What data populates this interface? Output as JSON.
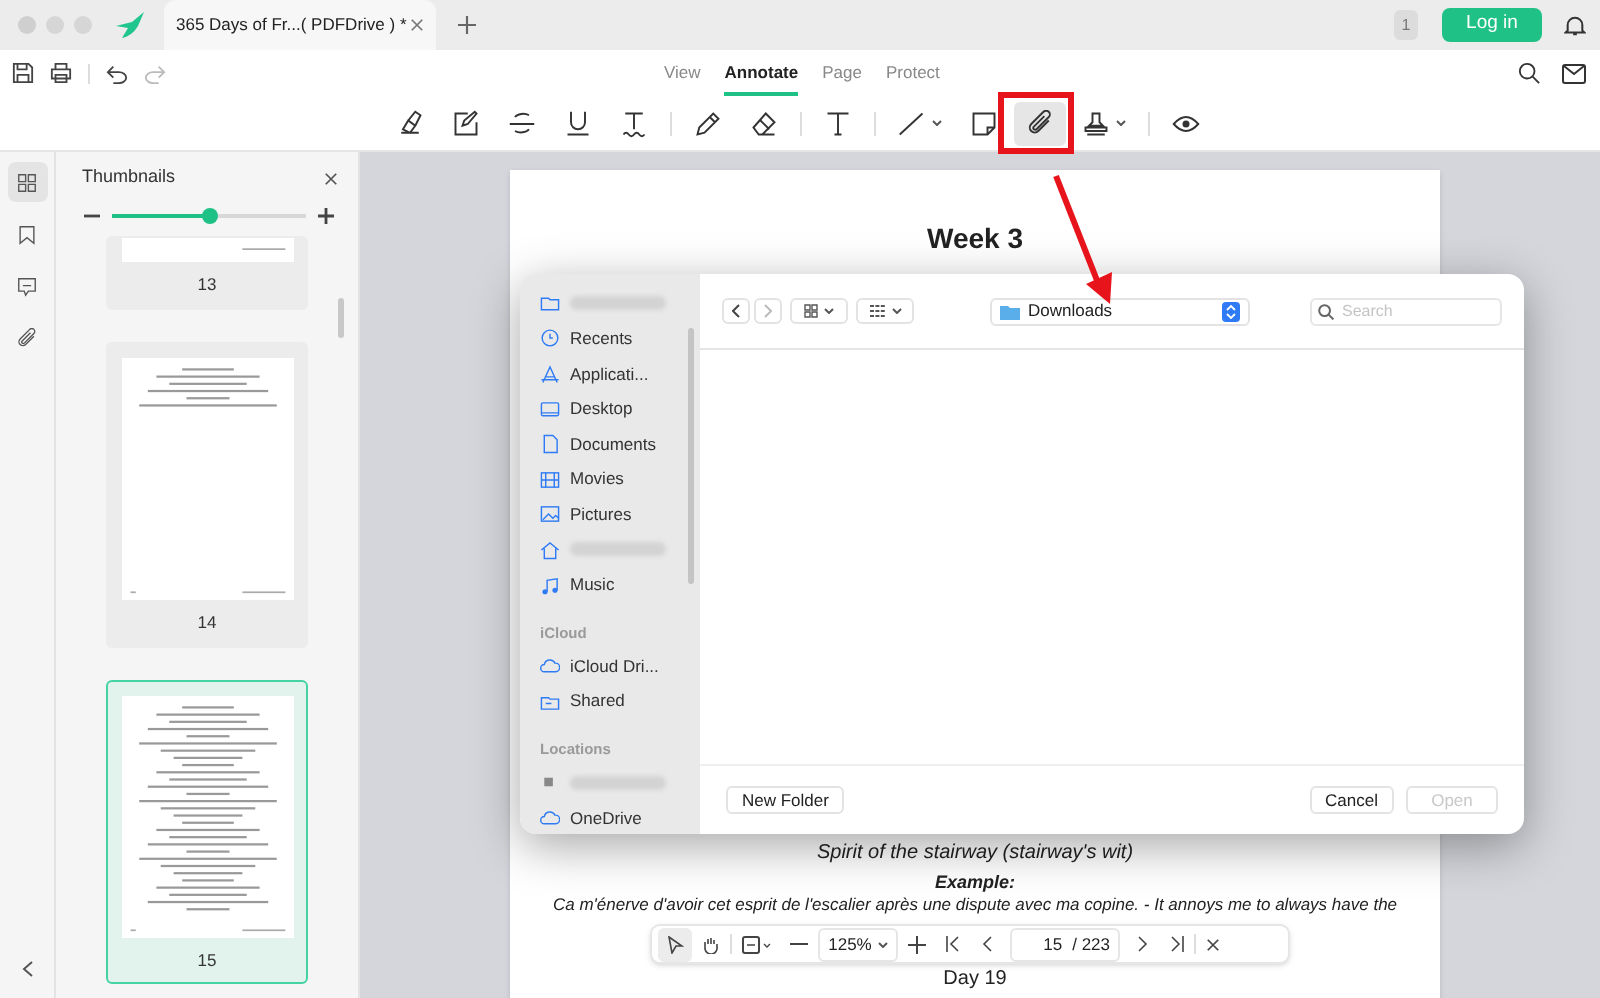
{
  "app_tab": {
    "title": "365 Days of Fr...( PDFDrive ) *"
  },
  "header": {
    "badge": "1",
    "login": "Log in"
  },
  "mode_tabs": [
    {
      "label": "View",
      "selected": false
    },
    {
      "label": "Annotate",
      "selected": true
    },
    {
      "label": "Page",
      "selected": false
    },
    {
      "label": "Protect",
      "selected": false
    }
  ],
  "tools": [
    {
      "kind": "highlighter",
      "selected": false
    },
    {
      "kind": "area",
      "selected": false
    },
    {
      "kind": "strikethrough",
      "selected": false
    },
    {
      "kind": "underline",
      "selected": false
    },
    {
      "kind": "squiggly",
      "selected": false
    },
    {
      "kind": "separator"
    },
    {
      "kind": "pencil",
      "selected": false
    },
    {
      "kind": "eraser",
      "selected": false
    },
    {
      "kind": "separator"
    },
    {
      "kind": "text",
      "selected": false
    },
    {
      "kind": "separator"
    },
    {
      "kind": "line",
      "selected": false
    },
    {
      "kind": "note",
      "selected": false
    },
    {
      "kind": "attachment",
      "selected": true
    },
    {
      "kind": "stamp",
      "selected": false
    },
    {
      "kind": "separator"
    },
    {
      "kind": "eye",
      "selected": false
    }
  ],
  "rail": [
    {
      "kind": "thumbnails",
      "selected": true
    },
    {
      "kind": "bookmark",
      "selected": false
    },
    {
      "kind": "comment",
      "selected": false
    },
    {
      "kind": "attachment",
      "selected": false
    }
  ],
  "thumbnails": {
    "title": "Thumbnails",
    "zoom": {
      "level": 0.5
    },
    "pages": [
      {
        "label": "13",
        "selected": false,
        "kind": "partial"
      },
      {
        "label": "14",
        "selected": false,
        "kind": "short"
      },
      {
        "label": "15",
        "selected": true,
        "kind": "full"
      }
    ]
  },
  "document": {
    "heading": "Week 3",
    "lines": [
      {
        "kind": "translation",
        "text": "Spirit of the stairway (stairway's wit)"
      },
      {
        "kind": "label",
        "text": "Example:"
      },
      {
        "kind": "body",
        "text": "Ca m'énerve d'avoir cet esprit de l'escalier après une dispute avec ma copine. - It annoys me to always have the"
      }
    ],
    "footer": "Day 19"
  },
  "dialog": {
    "folder": "Downloads",
    "search_placeholder": "Search",
    "sidebar": [
      {
        "kind": "blurred"
      },
      {
        "kind": "item",
        "label": "Recents"
      },
      {
        "kind": "item",
        "label": "Applicati..."
      },
      {
        "kind": "item",
        "label": "Desktop"
      },
      {
        "kind": "item",
        "label": "Documents"
      },
      {
        "kind": "item",
        "label": "Movies"
      },
      {
        "kind": "item",
        "label": "Pictures"
      },
      {
        "kind": "blurred"
      },
      {
        "kind": "item",
        "label": "Music"
      },
      {
        "kind": "header",
        "label": "iCloud"
      },
      {
        "kind": "item",
        "label": "iCloud Dri..."
      },
      {
        "kind": "item",
        "label": "Shared"
      },
      {
        "kind": "header",
        "label": "Locations"
      },
      {
        "kind": "blurred"
      },
      {
        "kind": "item",
        "label": "OneDrive"
      }
    ],
    "buttons": [
      {
        "label": "New Folder",
        "disabled": false
      },
      {
        "label": "Cancel",
        "disabled": false
      },
      {
        "label": "Open",
        "disabled": true
      }
    ]
  },
  "page_nav": {
    "zoom": "125%",
    "page": "15",
    "total": "/ 223"
  }
}
